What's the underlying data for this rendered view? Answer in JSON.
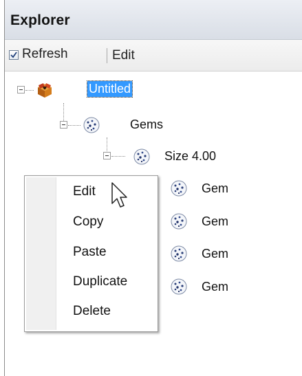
{
  "window": {
    "title": "Explorer"
  },
  "toolbar": {
    "refresh_checked": true,
    "refresh_label": "Refresh",
    "edit_label": "Edit"
  },
  "tree": {
    "root": {
      "label": "Untitled",
      "selected": true,
      "icon": "box-icon"
    },
    "gems": {
      "label": "Gems",
      "icon": "gem-icon"
    },
    "size": {
      "label": "Size 4.00",
      "icon": "gem-icon"
    },
    "items": [
      {
        "label": "Gem",
        "icon": "gem-icon"
      },
      {
        "label": "Gem",
        "icon": "gem-icon"
      },
      {
        "label": "Gem",
        "icon": "gem-icon"
      },
      {
        "label": "Gem",
        "icon": "gem-icon"
      }
    ]
  },
  "context_menu": {
    "items": [
      "Edit",
      "Copy",
      "Paste",
      "Duplicate",
      "Delete"
    ]
  },
  "colors": {
    "selection": "#3399ff",
    "title_bar": "#dde2ea",
    "toolbar": "#f0f0f0"
  }
}
